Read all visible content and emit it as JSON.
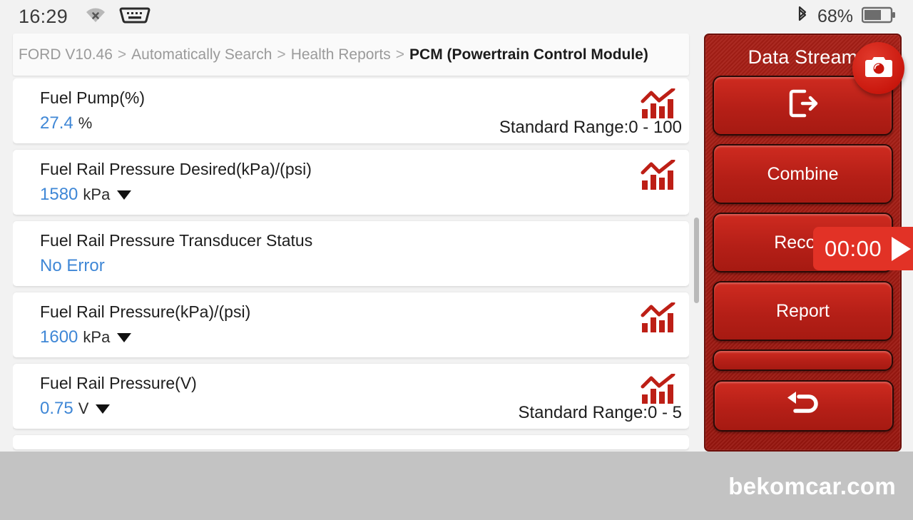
{
  "status_bar": {
    "clock": "16:29",
    "icons": [
      "wifi-off-icon",
      "obd-connector-icon",
      "bluetooth-icon"
    ],
    "battery_percent": "68%"
  },
  "breadcrumb": {
    "items": [
      {
        "label": "FORD V10.46",
        "active": false
      },
      {
        "label": "Automatically Search",
        "active": false
      },
      {
        "label": "Health Reports",
        "active": false
      },
      {
        "label": "PCM (Powertrain Control Module)",
        "active": true
      }
    ],
    "separator": ">"
  },
  "data_stream": {
    "rows": [
      {
        "name": "Fuel Pump(%)",
        "value": "27.4",
        "unit": "%",
        "has_caret": false,
        "range": "Standard Range:0 - 100",
        "has_chart_icon": true
      },
      {
        "name": "Fuel Rail Pressure Desired(kPa)/(psi)",
        "value": "1580",
        "unit": "kPa",
        "has_caret": true,
        "range": "",
        "has_chart_icon": true
      },
      {
        "name": "Fuel Rail Pressure Transducer Status",
        "value": "No Error",
        "unit": "",
        "has_caret": false,
        "range": "",
        "has_chart_icon": false
      },
      {
        "name": "Fuel Rail Pressure(kPa)/(psi)",
        "value": "1600",
        "unit": "kPa",
        "has_caret": true,
        "range": "",
        "has_chart_icon": true
      },
      {
        "name": "Fuel Rail Pressure(V)",
        "value": "0.75",
        "unit": "V",
        "has_caret": true,
        "range": "Standard Range:0 - 5",
        "has_chart_icon": true
      }
    ]
  },
  "panel": {
    "title": "Data Stream",
    "camera_button": "camera-icon",
    "buttons": [
      {
        "label": "",
        "icon": "exit-icon"
      },
      {
        "label": "Combine",
        "icon": ""
      },
      {
        "label": "Record",
        "icon": ""
      },
      {
        "label": "Report",
        "icon": ""
      }
    ],
    "back_button_icon": "back-arrow-icon"
  },
  "timer_overlay": {
    "time": "00:00",
    "play_icon": "play-icon"
  },
  "bottom_bar": {
    "watermark": "bekomcar.com"
  },
  "colors": {
    "panel_red": "#a71f16",
    "button_red": "#b51f17",
    "value_blue": "#3f87d6",
    "accent_red": "#c21a10",
    "bottom_grey": "#c3c3c3"
  }
}
